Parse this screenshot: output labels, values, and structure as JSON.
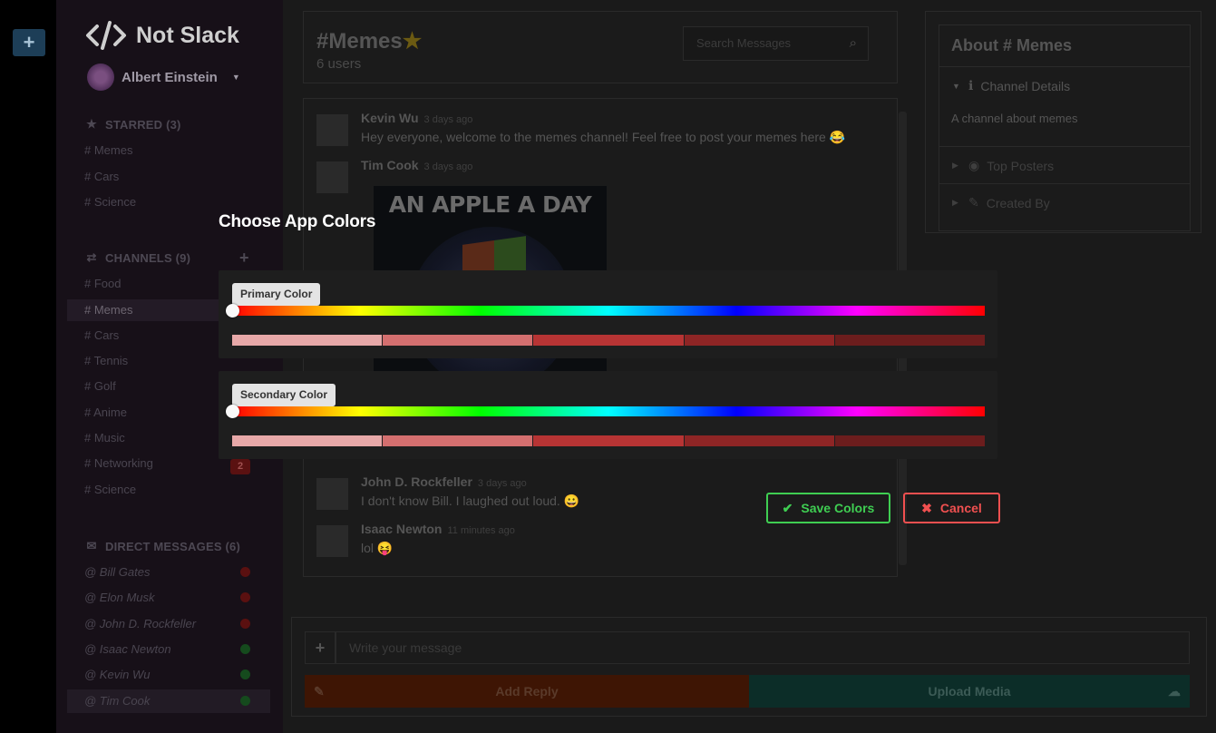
{
  "app": {
    "name": "Not Slack"
  },
  "user": {
    "name": "Albert Einstein"
  },
  "sidebar": {
    "starred": {
      "title": "STARRED (3)",
      "items": [
        "# Memes",
        "# Cars",
        "# Science"
      ]
    },
    "channels": {
      "title": "CHANNELS (9)",
      "items": [
        "# Food",
        "# Memes",
        "# Cars",
        "# Tennis",
        "# Golf",
        "# Anime",
        "# Music",
        "# Networking",
        "# Science"
      ],
      "active": "# Memes",
      "networking_badge": "2"
    },
    "dms": {
      "title": "DIRECT MESSAGES (6)",
      "items": [
        {
          "name": "@ Bill Gates",
          "status": "offline"
        },
        {
          "name": "@ Elon Musk",
          "status": "offline"
        },
        {
          "name": "@ John D. Rockfeller",
          "status": "offline"
        },
        {
          "name": "@ Isaac Newton",
          "status": "online"
        },
        {
          "name": "@ Kevin Wu",
          "status": "online"
        },
        {
          "name": "@ Tim Cook",
          "status": "online"
        }
      ]
    }
  },
  "channel": {
    "title": "#Memes",
    "users": "6 users",
    "search_placeholder": "Search Messages"
  },
  "messages": [
    {
      "author": "Kevin Wu",
      "time": "3 days ago",
      "text": "Hey everyone, welcome to the memes channel! Feel free to post your memes here 😂"
    },
    {
      "author": "Tim Cook",
      "time": "3 days ago",
      "image_caption": "AN APPLE A DAY"
    },
    {
      "author": "John D. Rockfeller",
      "time": "3 days ago",
      "text": "I don't know Bill. I laughed out loud. 😀"
    },
    {
      "author": "Isaac Newton",
      "time": "11 minutes ago",
      "text": "lol 😝"
    }
  ],
  "about": {
    "title": "About # Memes",
    "channel_details": "Channel Details",
    "description": "A channel about memes",
    "top_posters": "Top Posters",
    "created_by": "Created By"
  },
  "compose": {
    "placeholder": "Write your message",
    "add_reply": "Add Reply",
    "upload_media": "Upload Media"
  },
  "modal": {
    "title": "Choose App Colors",
    "primary_label": "Primary Color",
    "secondary_label": "Secondary Color",
    "shades": [
      "#e7a8a8",
      "#d46f6f",
      "#b73434",
      "#8e2525",
      "#6c1d1d"
    ],
    "save": "Save Colors",
    "cancel": "Cancel"
  },
  "colors": {
    "save": "#3fce52",
    "cancel": "#f05050"
  }
}
